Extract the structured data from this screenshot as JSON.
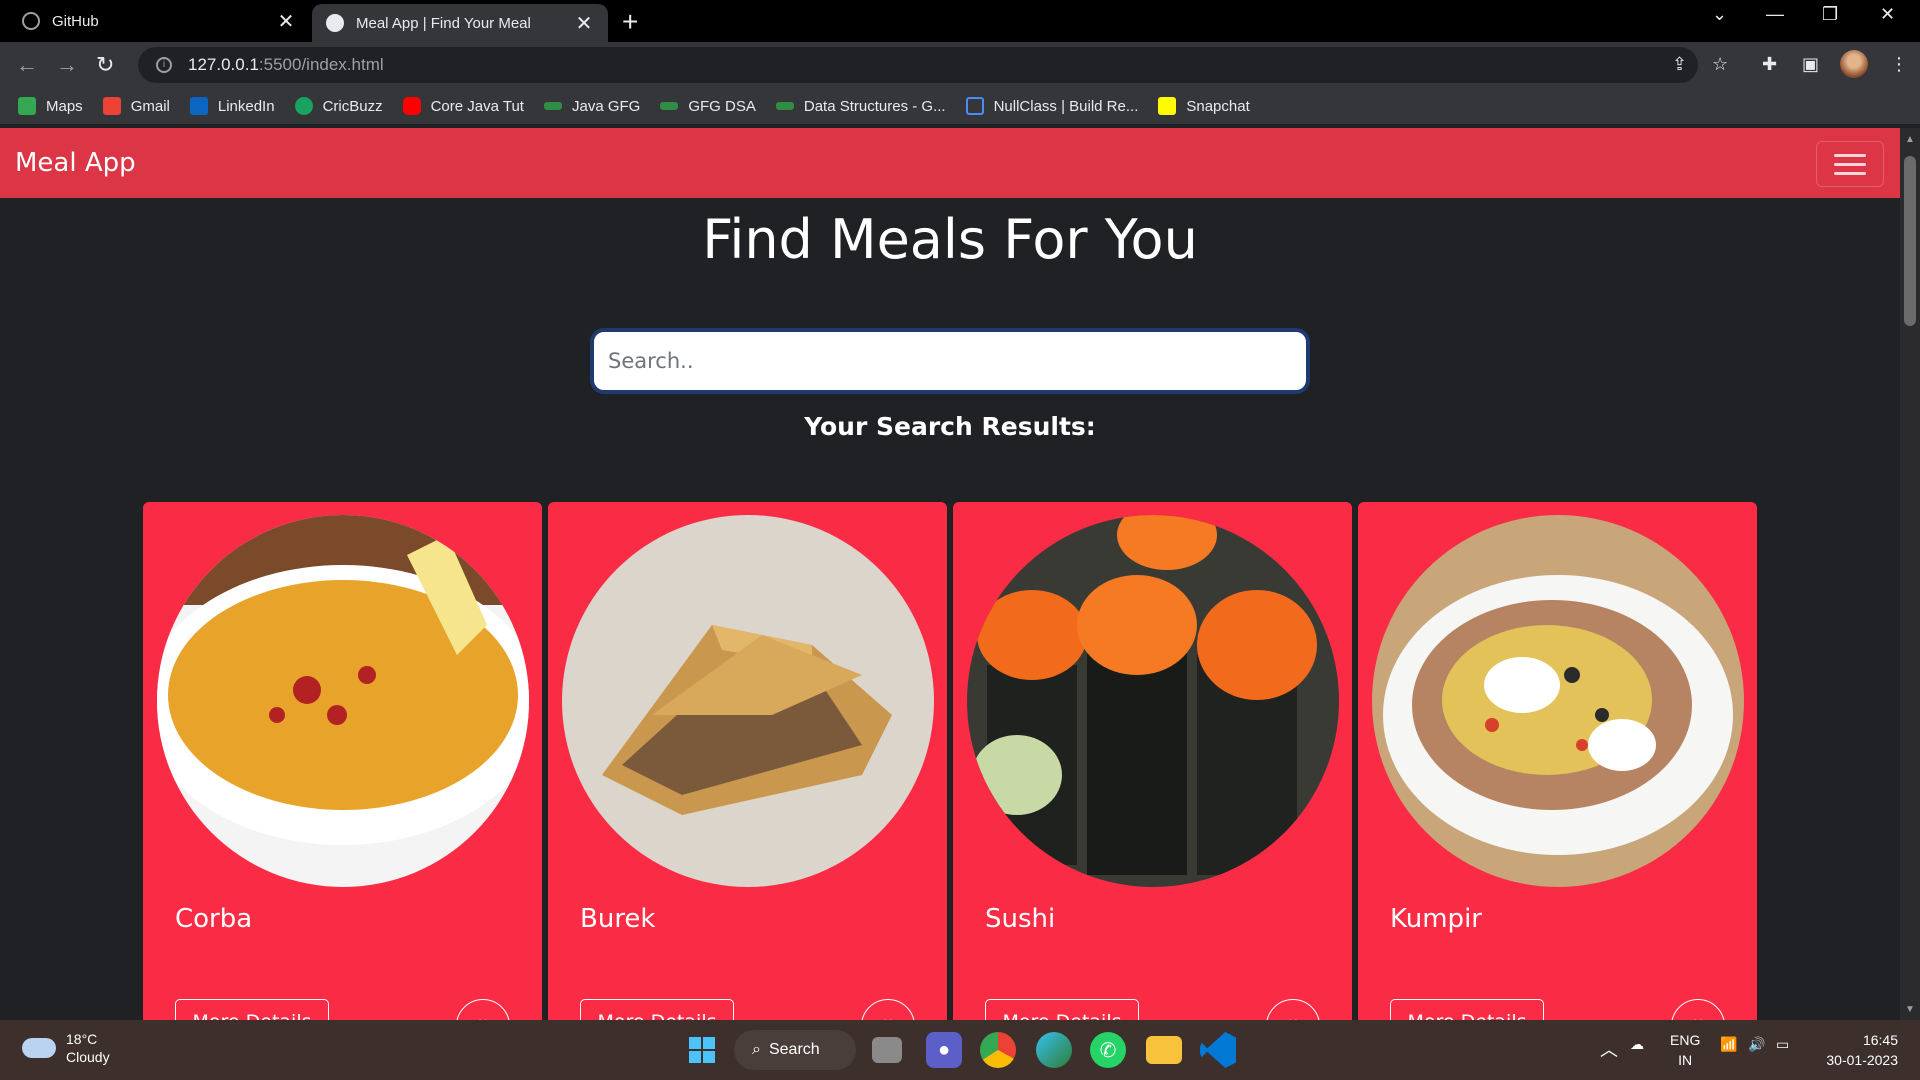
{
  "browser": {
    "tabs": [
      {
        "title": "GitHub",
        "active": false
      },
      {
        "title": "Meal App | Find Your Meal",
        "active": true
      }
    ],
    "url_host": "127.0.0.1",
    "url_path": ":5500/index.html",
    "bookmarks": [
      {
        "label": "Maps",
        "color": "#34a853"
      },
      {
        "label": "Gmail",
        "color": "#ea4335"
      },
      {
        "label": "LinkedIn",
        "color": "#0a66c2"
      },
      {
        "label": "CricBuzz",
        "color": "#1aa260"
      },
      {
        "label": "Core Java Tut",
        "color": "#ff0000"
      },
      {
        "label": "Java GFG",
        "color": "#2f8d46"
      },
      {
        "label": "GFG DSA",
        "color": "#2f8d46"
      },
      {
        "label": "Data Structures - G...",
        "color": "#2f8d46"
      },
      {
        "label": "NullClass | Build Re...",
        "color": "#4c8bf5"
      },
      {
        "label": "Snapchat",
        "color": "#fffc00"
      }
    ]
  },
  "app": {
    "brand": "Meal App",
    "heading": "Find Meals For You",
    "search_placeholder": "Search..",
    "results_title": "Your Search Results:",
    "meals": [
      {
        "name": "Corba",
        "more_label": "More Details"
      },
      {
        "name": "Burek",
        "more_label": "More Details"
      },
      {
        "name": "Sushi",
        "more_label": "More Details"
      },
      {
        "name": "Kumpir",
        "more_label": "More Details"
      }
    ],
    "accent": "#dc3545",
    "card_color": "#fa2c45"
  },
  "taskbar": {
    "temperature": "18°C",
    "weather": "Cloudy",
    "search_label": "Search",
    "lang": "ENG",
    "region": "IN",
    "time": "16:45",
    "date": "30-01-2023"
  }
}
